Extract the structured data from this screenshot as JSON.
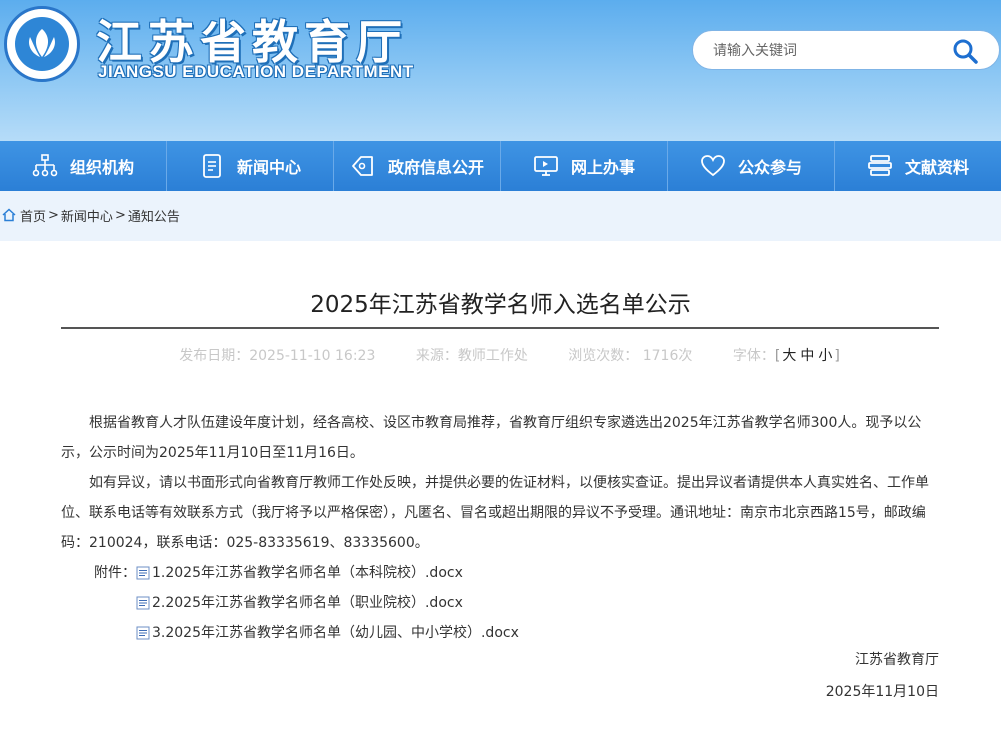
{
  "header": {
    "title": "江苏省教育厅",
    "subtitle": "JIANGSU EDUCATION DEPARTMENT",
    "search_placeholder": "请输入关键词"
  },
  "nav": {
    "items": [
      {
        "label": "组织机构",
        "icon": "org-chart-icon"
      },
      {
        "label": "新闻中心",
        "icon": "document-icon"
      },
      {
        "label": "政府信息公开",
        "icon": "tag-icon"
      },
      {
        "label": "网上办事",
        "icon": "monitor-icon"
      },
      {
        "label": "公众参与",
        "icon": "heart-icon"
      },
      {
        "label": "文献资料",
        "icon": "books-icon"
      }
    ]
  },
  "breadcrumb": {
    "home": "首页",
    "news": "新闻中心",
    "notice": "通知公告"
  },
  "article": {
    "title": "2025年江苏省教学名师入选名单公示",
    "meta": {
      "publish_date": "发布日期：2025-11-10 16:23",
      "source": "来源：教师工作处",
      "views": "浏览次数：  1716次",
      "font_size_label": "字体：",
      "font_size_large": "大",
      "font_size_medium": "中",
      "font_size_small": "小"
    },
    "paragraph1": "根据省教育人才队伍建设年度计划，经各高校、设区市教育局推荐，省教育厅组织专家遴选出2025年江苏省教学名师300人。现予以公示，公示时间为2025年11月10日至11月16日。",
    "paragraph2": "如有异议，请以书面形式向省教育厅教师工作处反映，并提供必要的佐证材料，以便核实查证。提出异议者请提供本人真实姓名、工作单位、联系电话等有效联系方式（我厅将予以严格保密），凡匿名、冒名或超出期限的异议不予受理。通讯地址：南京市北京西路15号，邮政编码：210024，联系电话：025-83335619、83335600。",
    "attachment_label": "附件：",
    "attachments": [
      "1.2025年江苏省教学名师名单（本科院校）.docx",
      "2.2025年江苏省教学名师名单（职业院校）.docx",
      "3.2025年江苏省教学名师名单（幼儿园、中小学校）.docx"
    ],
    "signature": "江苏省教育厅",
    "sign_date": "2025年11月10日"
  },
  "colors": {
    "header_top": "#5cadee",
    "nav_bg": "#2b7fd6",
    "title_rule": "#555555",
    "meta_text": "#c8c8c8"
  }
}
